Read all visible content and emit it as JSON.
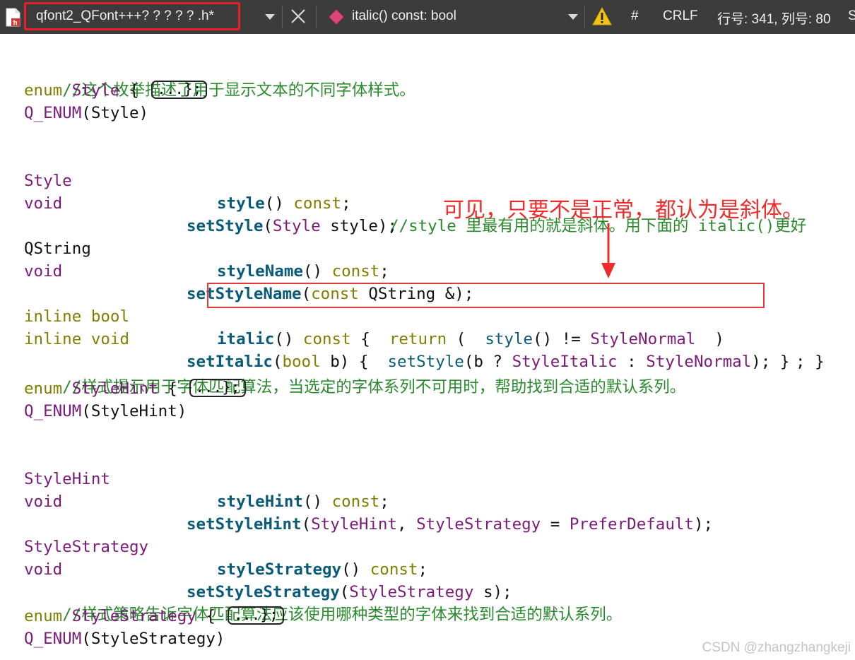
{
  "toolbar": {
    "file_name": "qfont2_QFont+++? ? ? ? ? .h*",
    "symbol_label": "italic() const: bool",
    "hash_label": "#",
    "line_ending": "CRLF",
    "position_label": "行号: 341, 列号: 80",
    "trailing_text": "S",
    "icons": {
      "file": "header-file-icon",
      "tab_dropdown": "chevron-down-icon",
      "close": "close-icon",
      "symbol": "method-diamond-icon",
      "symbol_dropdown": "chevron-down-icon",
      "warning": "warning-triangle-icon"
    }
  },
  "code": {
    "comment_style": "//这个枚举描述了用于显示文本的不同字体样式。",
    "enum_style": {
      "kw": "enum",
      "name": "Style",
      "brace": " {",
      "fold": "...};"
    },
    "q_enum_style": {
      "macro": "Q_ENUM",
      "arg": "(Style)"
    },
    "style_getter": {
      "type": "Style",
      "name": "style",
      "tail": "()",
      "const": "const",
      "semi": ";",
      "comment": "//style 里最有用的就是斜体。用下面的 italic()更好"
    },
    "style_setter": {
      "type": "void",
      "name": "setStyle",
      "paren": "(",
      "ptype": "Style",
      "rest": " style);"
    },
    "stylename_getter": {
      "type": "QString",
      "name": "styleName",
      "tail": "()",
      "const": "const",
      "semi": ";"
    },
    "stylename_setter": {
      "type": "void",
      "name": "setStyleName",
      "paren": "(",
      "const": "const",
      "rest": " QString &);"
    },
    "italic_getter": {
      "inline": "inline",
      "type": "bool",
      "name": "italic",
      "p1": "()",
      "const": "const",
      "p2": " {  ",
      "ret": "return",
      "p3": " (  ",
      "call": "style",
      "p4": "() != ",
      "enumval": "StyleNormal",
      "p5": "  )",
      "p6": "; }"
    },
    "italic_setter": {
      "inline": "inline",
      "type": "void",
      "name": "setItalic",
      "paren": "(",
      "ptype": "bool",
      "p1": " b) {  ",
      "call": "setStyle",
      "p2": "(b ? ",
      "v1": "StyleItalic",
      "p3": " : ",
      "v2": "StyleNormal",
      "p4": "); }"
    },
    "comment_hint": "//样式提示用于字体匹配算法，当选定的字体系列不可用时，帮助找到合适的默认系列。",
    "enum_hint": {
      "kw": "enum",
      "name": "StyleHint",
      "brace": " {",
      "fold": "...};"
    },
    "q_enum_hint": {
      "macro": "Q_ENUM",
      "arg": "(StyleHint)"
    },
    "hint_getter": {
      "type": "StyleHint",
      "name": "styleHint",
      "tail": "()",
      "const": "const",
      "semi": ";"
    },
    "hint_setter": {
      "type": "void",
      "name": "setStyleHint",
      "paren": "(",
      "pt1": "StyleHint",
      "comma": ", ",
      "pt2": "StyleStrategy",
      "eq": " = ",
      "def": "PreferDefault",
      "end": ");"
    },
    "strategy_getter": {
      "type": "StyleStrategy",
      "name": "styleStrategy",
      "tail": "()",
      "const": "const",
      "semi": ";"
    },
    "strategy_setter": {
      "type": "void",
      "name": "setStyleStrategy",
      "paren": "(",
      "ptype": "StyleStrategy",
      "rest": " s);"
    },
    "comment_strategy": "//样式策略告诉字体匹配算法应该使用哪种类型的字体来找到合适的默认系列。",
    "enum_strategy": {
      "kw": "enum",
      "name": "StyleStrategy",
      "brace": " {",
      "fold": "...};"
    },
    "q_enum_strategy": {
      "macro": "Q_ENUM",
      "arg": "(StyleStrategy)"
    }
  },
  "annotation": {
    "text": "可见，只要不是正常，都认为是斜体。",
    "color": "#ee2b2b"
  },
  "watermark": "CSDN @zhangzhangkeji",
  "colors": {
    "toolbar_bg": "#3c3c3c",
    "highlight_border": "#e23a3a",
    "comment": "#2b8a2e",
    "type": "#7a1a7a",
    "keyword": "#808000",
    "function": "#0a5b7a"
  }
}
